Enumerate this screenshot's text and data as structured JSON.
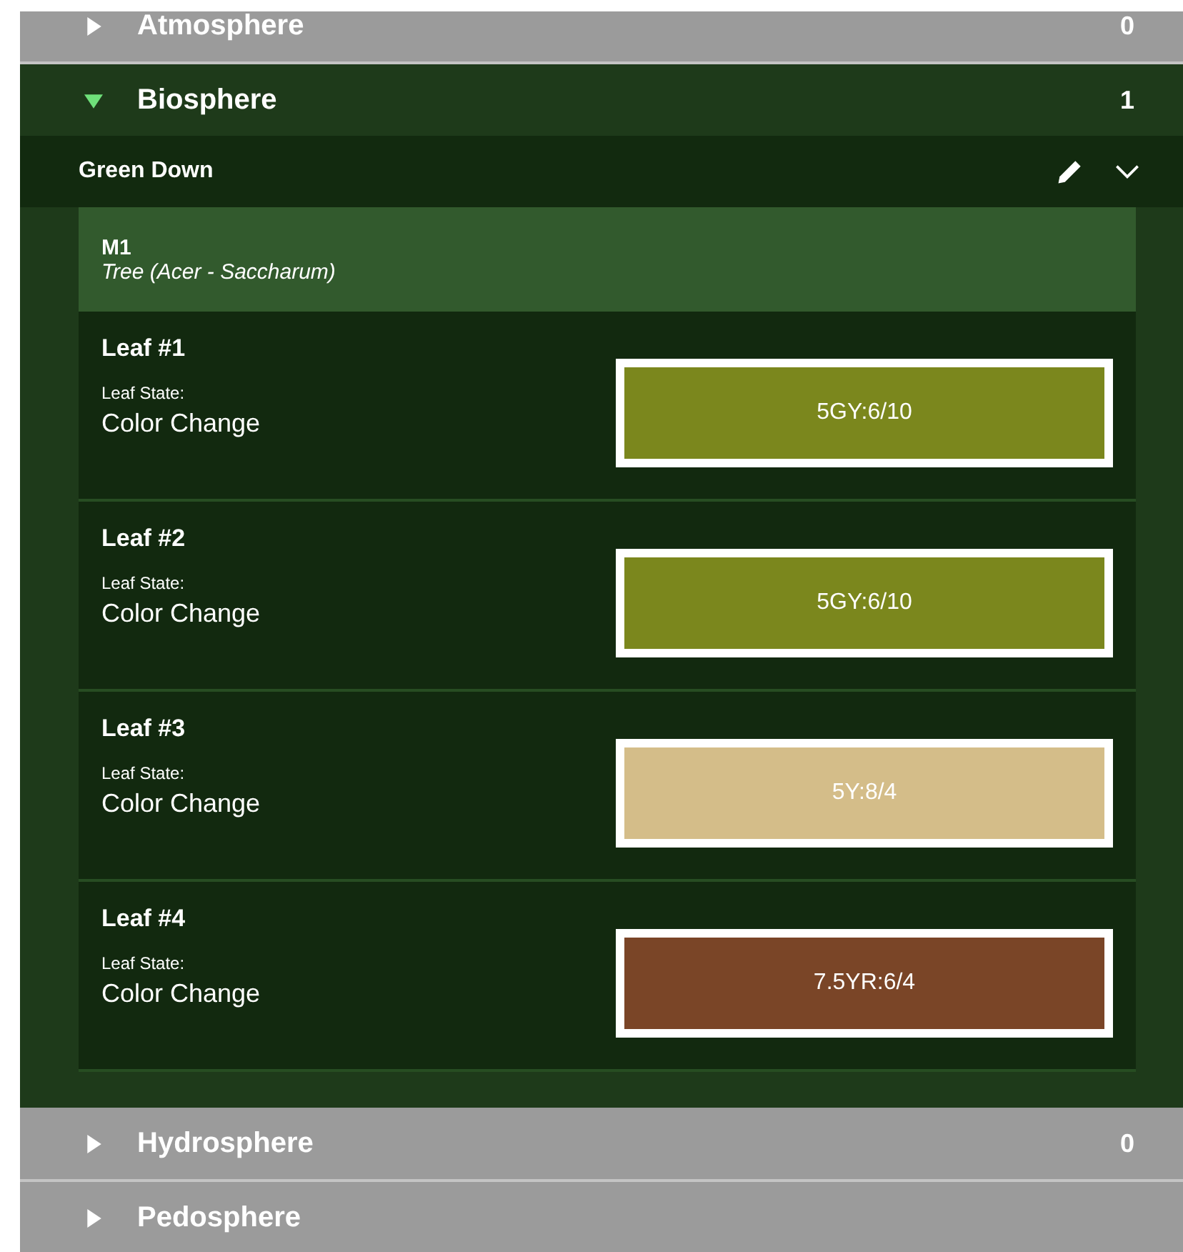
{
  "sections": [
    {
      "name": "Atmosphere",
      "count": "0",
      "expanded": false
    },
    {
      "name": "Biosphere",
      "count": "1",
      "expanded": true,
      "group": {
        "title": "Green Down",
        "sample": {
          "id": "M1",
          "species": "Tree (Acer - Saccharum)"
        },
        "leaves": [
          {
            "title": "Leaf #1",
            "state_label": "Leaf State:",
            "state": "Color Change",
            "munsell": "5GY:6/10",
            "color": "#7b871d"
          },
          {
            "title": "Leaf #2",
            "state_label": "Leaf State:",
            "state": "Color Change",
            "munsell": "5GY:6/10",
            "color": "#7b871d"
          },
          {
            "title": "Leaf #3",
            "state_label": "Leaf State:",
            "state": "Color Change",
            "munsell": "5Y:8/4",
            "color": "#d4bd89"
          },
          {
            "title": "Leaf #4",
            "state_label": "Leaf State:",
            "state": "Color Change",
            "munsell": "7.5YR:6/4",
            "color": "#7a4527"
          }
        ]
      }
    },
    {
      "name": "Hydrosphere",
      "count": "0",
      "expanded": false
    },
    {
      "name": "Pedosphere",
      "expanded": false
    }
  ]
}
